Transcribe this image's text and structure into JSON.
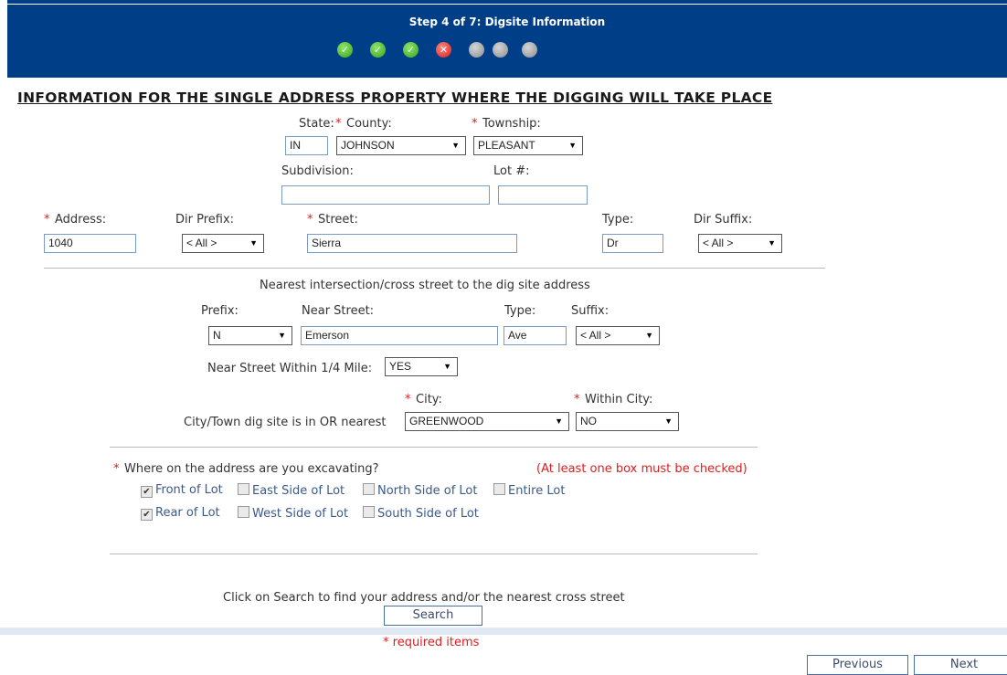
{
  "header": {
    "title": "Step 4 of 7: Digsite Information",
    "steps": [
      {
        "status": "done",
        "icon": "check-icon",
        "glyph": "✓"
      },
      {
        "status": "done",
        "icon": "check-icon",
        "glyph": "✓"
      },
      {
        "status": "done",
        "icon": "check-icon",
        "glyph": "✓"
      },
      {
        "status": "error",
        "icon": "error-x-icon",
        "glyph": "✕"
      },
      {
        "status": "todo",
        "icon": "pending-dot-icon",
        "glyph": ""
      },
      {
        "status": "todo",
        "icon": "pending-dot-icon",
        "glyph": ""
      },
      {
        "status": "todo",
        "icon": "pending-dot-icon",
        "glyph": ""
      }
    ]
  },
  "section_title": "INFORMATION FOR THE SINGLE ADDRESS PROPERTY WHERE THE DIGGING WILL TAKE PLACE",
  "location": {
    "state_label": "State:",
    "state_value": "IN",
    "county_label": "County:",
    "county_value": "JOHNSON",
    "township_label": "Township:",
    "township_value": "PLEASANT",
    "subdivision_label": "Subdivision:",
    "subdivision_value": "",
    "lot_label": "Lot #:",
    "lot_value": ""
  },
  "address": {
    "address_label": "Address:",
    "address_value": "1040",
    "dir_prefix_label": "Dir Prefix:",
    "dir_prefix_value": "< All >",
    "street_label": "Street:",
    "street_value": "Sierra",
    "type_label": "Type:",
    "type_value": "Dr",
    "dir_suffix_label": "Dir Suffix:",
    "dir_suffix_value": "< All >"
  },
  "intersection": {
    "heading": "Nearest intersection/cross street to the dig site address",
    "prefix_label": "Prefix:",
    "prefix_value": "N",
    "near_street_label": "Near Street:",
    "near_street_value": "Emerson",
    "type_label": "Type:",
    "type_value": "Ave",
    "suffix_label": "Suffix:",
    "suffix_value": "< All >",
    "within_label": "Near Street Within 1/4 Mile:",
    "within_value": "YES"
  },
  "city": {
    "city_label": "City:",
    "within_city_label": "Within City:",
    "row_label": "City/Town dig site is in OR nearest",
    "city_value": "GREENWOOD",
    "within_city_value": "NO"
  },
  "excavation": {
    "question": "Where on the address are you excavating?",
    "warning": "(At least one box must be checked)",
    "options": [
      {
        "label": "Front of Lot",
        "checked": true
      },
      {
        "label": "East Side of Lot",
        "checked": false
      },
      {
        "label": "North Side of Lot",
        "checked": false
      },
      {
        "label": "Entire Lot",
        "checked": false
      },
      {
        "label": "Rear of Lot",
        "checked": true
      },
      {
        "label": "West Side of Lot",
        "checked": false
      },
      {
        "label": "South Side of Lot",
        "checked": false
      }
    ]
  },
  "search": {
    "instruction": "Click on Search to find your address and/or the nearest cross street",
    "button_label": "Search",
    "required_note": "* required items"
  },
  "nav": {
    "previous_label": "Previous",
    "next_label": "Next"
  },
  "colors": {
    "header_bg": "#003f87",
    "required": "#e01c1c",
    "link_text": "#3b5a8a"
  },
  "required_marker": "*"
}
